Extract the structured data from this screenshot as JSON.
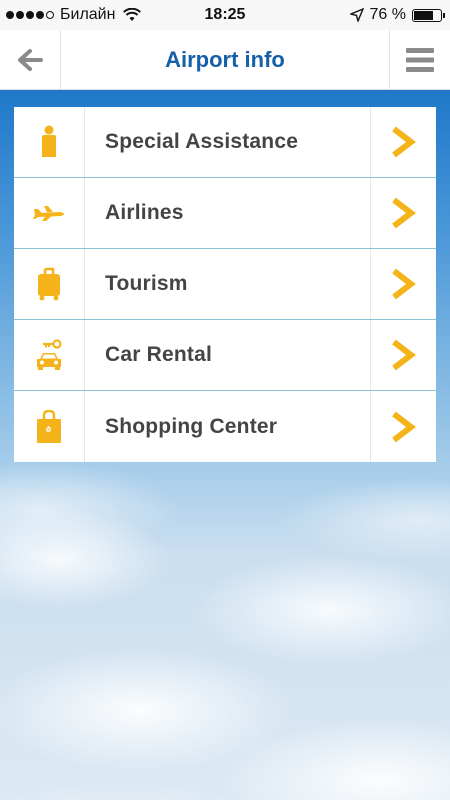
{
  "status_bar": {
    "carrier": "Билайн",
    "time": "18:25",
    "battery": "76 %",
    "battery_level": 0.76
  },
  "navbar": {
    "title": "Airport info",
    "back_icon": "back-arrow-icon",
    "menu_icon": "hamburger-menu-icon"
  },
  "menu": {
    "items": [
      {
        "label": "Special Assistance",
        "icon": "person-icon"
      },
      {
        "label": "Airlines",
        "icon": "airplane-icon"
      },
      {
        "label": "Tourism",
        "icon": "luggage-icon"
      },
      {
        "label": "Car Rental",
        "icon": "car-key-icon"
      },
      {
        "label": "Shopping Center",
        "icon": "shopping-bag-icon"
      }
    ]
  },
  "colors": {
    "accent": "#f5b31a",
    "title": "#1560a8",
    "divider": "#8fc3db"
  }
}
